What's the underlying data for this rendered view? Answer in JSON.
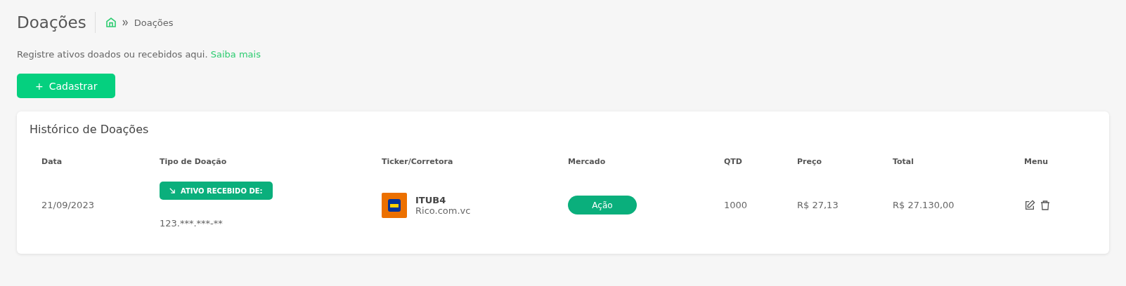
{
  "header": {
    "title": "Doações",
    "breadcrumb": [
      "Doações"
    ]
  },
  "intro": {
    "text": "Registre ativos doados ou recebidos aqui.",
    "link": "Saiba mais"
  },
  "add_button": {
    "icon": "+",
    "label": "Cadastrar"
  },
  "history": {
    "title": "Histórico de Doações",
    "columns": [
      "Data",
      "Tipo de Doação",
      "Ticker/Corretora",
      "Mercado",
      "QTD",
      "Preço",
      "Total",
      "Menu"
    ],
    "rows": [
      {
        "date": "21/09/2023",
        "donation_type": {
          "kind": "received",
          "label": "ATIVO RECEBIDO DE:"
        },
        "counterparty": "123.***.***-**",
        "ticker": "ITUB4",
        "broker": "Rico.com.vc",
        "market": "Ação",
        "qty": "1000",
        "price": "R$ 27,13",
        "total": "R$ 27.130,00"
      }
    ]
  }
}
